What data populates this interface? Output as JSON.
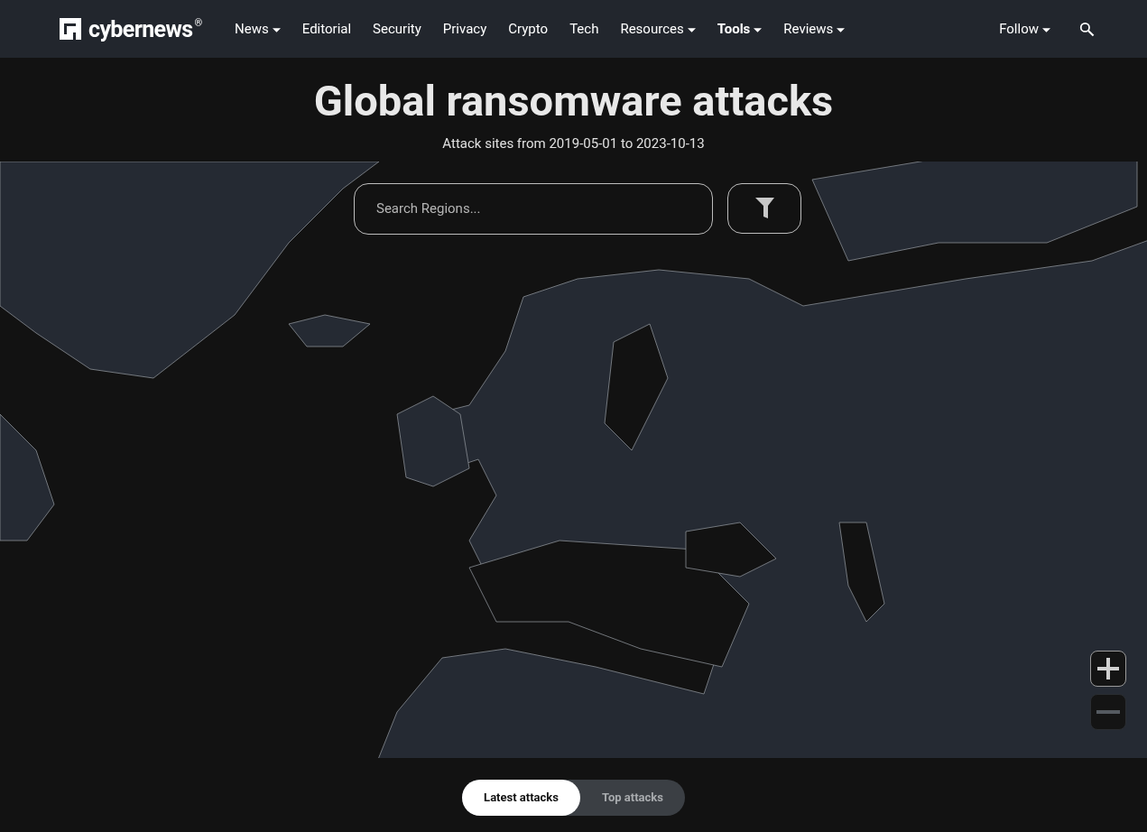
{
  "header": {
    "logo": {
      "text": "cybernews",
      "mark": "®"
    },
    "nav": [
      {
        "label": "News",
        "has_menu": true,
        "selected": false
      },
      {
        "label": "Editorial",
        "has_menu": false,
        "selected": false
      },
      {
        "label": "Security",
        "has_menu": false,
        "selected": false
      },
      {
        "label": "Privacy",
        "has_menu": false,
        "selected": false
      },
      {
        "label": "Crypto",
        "has_menu": false,
        "selected": false
      },
      {
        "label": "Tech",
        "has_menu": false,
        "selected": false
      },
      {
        "label": "Resources",
        "has_menu": true,
        "selected": false
      },
      {
        "label": "Tools",
        "has_menu": true,
        "selected": true
      },
      {
        "label": "Reviews",
        "has_menu": true,
        "selected": false
      }
    ],
    "follow": {
      "label": "Follow",
      "has_menu": true
    }
  },
  "title": "Global ransomware attacks",
  "subtitle": "Attack sites from 2019-05-01 to 2023-10-13",
  "map": {
    "search": {
      "placeholder": "Search Regions..."
    },
    "zoom": [
      {
        "kind": "in",
        "disabled": false
      },
      {
        "kind": "out",
        "disabled": true
      }
    ]
  },
  "tabs": [
    {
      "label": "Latest attacks",
      "selected": true
    },
    {
      "label": "Top attacks",
      "selected": false
    }
  ]
}
